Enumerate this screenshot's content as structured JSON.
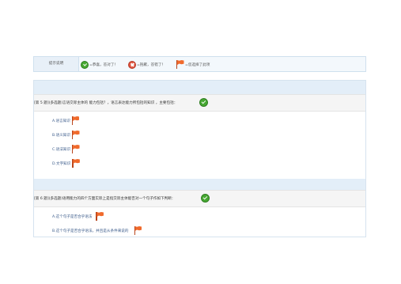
{
  "legend": {
    "label": "提示说明",
    "items": [
      {
        "icon": "check-icon",
        "text": "=恭喜，答对了！"
      },
      {
        "icon": "cross-icon",
        "text": "=抱歉，答错了！"
      },
      {
        "icon": "flag-icon",
        "text": "=您选择了此项"
      }
    ]
  },
  "questions": [
    {
      "text": "[第 5 题](多选题)言语交际主体的    能力包括？，语言表达能力所包括的知识    ，主要包括：",
      "result_icon": "check-icon",
      "options": [
        "A.语言知识",
        "B.语义知识",
        "C.语法知识",
        "D.文字知识"
      ]
    },
    {
      "text": "[第 6 题](多选题)语用能力的四个方面实际上是指交际主体能否对一个句子作如下判断：",
      "result_icon": "check-icon",
      "options": [
        "A.这个句子是否合乎语法",
        "B.这个句子是否合乎语法，并且是从条件来说的"
      ]
    }
  ],
  "colors": {
    "check": "#46a832",
    "cross": "#e0543f",
    "flag": "#f06a2c",
    "band": "#e3eef8"
  }
}
